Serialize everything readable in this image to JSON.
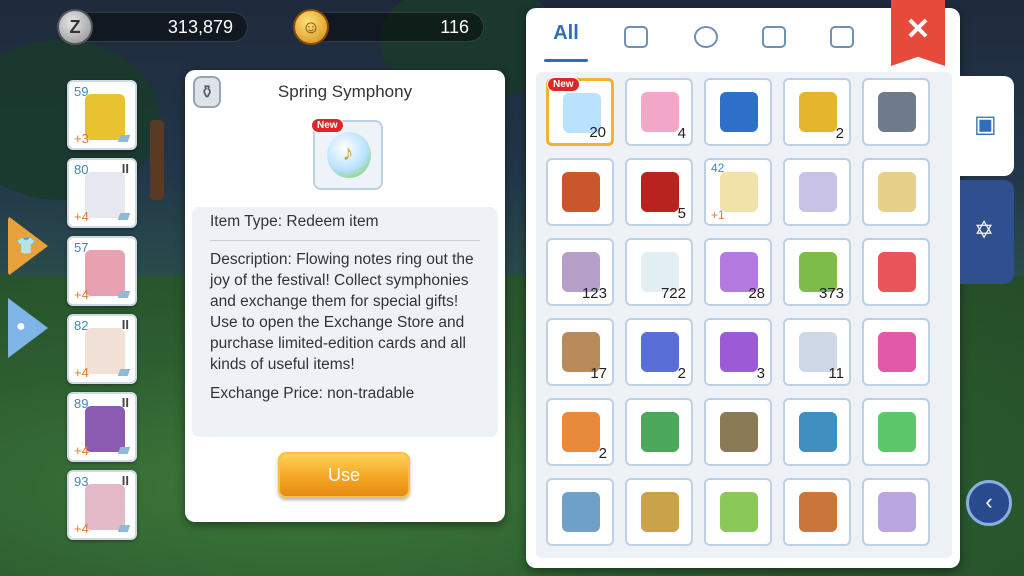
{
  "currency": {
    "zeny_icon": "Z",
    "zeny": "313,879",
    "coin_icon": "cat-coin-icon",
    "coin": "116"
  },
  "equipment": [
    {
      "level": "59",
      "tier": "",
      "refine": "+3",
      "icon": "gold-armor-icon",
      "color": "#e8c22f"
    },
    {
      "level": "80",
      "tier": "II",
      "refine": "+4",
      "icon": "white-coat-icon",
      "color": "#e5e8ee"
    },
    {
      "level": "57",
      "tier": "",
      "refine": "+4",
      "icon": "cape-icon",
      "color": "#e7a1b0"
    },
    {
      "level": "82",
      "tier": "II",
      "refine": "+4",
      "icon": "boots-icon",
      "color": "#f2e1d6"
    },
    {
      "level": "89",
      "tier": "II",
      "refine": "+4",
      "icon": "gem-accessory-icon",
      "color": "#8a5bb0"
    },
    {
      "level": "93",
      "tier": "II",
      "refine": "+4",
      "icon": "glove-icon",
      "color": "#e3b9c8"
    }
  ],
  "dialog": {
    "title": "Spring Symphony",
    "new_badge": "New",
    "item_type": "Item Type: Redeem item",
    "description": "Description: Flowing notes ring out the joy of the festival! Collect symphonies and exchange them for special gifts! Use to open the Exchange Store and purchase limited-edition cards and all kinds of useful items!",
    "price": "Exchange Price: non-tradable",
    "use_label": "Use"
  },
  "inventory": {
    "tabs": [
      {
        "label": "All",
        "icon": ""
      },
      {
        "label": "",
        "icon": "shirt-icon"
      },
      {
        "label": "",
        "icon": "potion-icon"
      },
      {
        "label": "",
        "icon": "grid-icon"
      },
      {
        "label": "",
        "icon": "card-icon"
      }
    ],
    "close_label": "✕",
    "items": [
      {
        "qty": "20",
        "icon": "spring-symphony-icon",
        "color": "#b9e2ff",
        "badge": "New",
        "selected": true
      },
      {
        "qty": "4",
        "icon": "pink-dust-icon",
        "color": "#f2a6c8"
      },
      {
        "qty": "",
        "icon": "blue-shield-card-icon",
        "color": "#2f6fc9"
      },
      {
        "qty": "2",
        "icon": "gold-card-icon",
        "color": "#e5b52b"
      },
      {
        "qty": "",
        "icon": "metal-ring-icon",
        "color": "#6f7b8a"
      },
      {
        "qty": "",
        "icon": "bird-pet-icon",
        "color": "#c9572b"
      },
      {
        "qty": "5",
        "icon": "red-sword-card-icon",
        "color": "#b8231f"
      },
      {
        "qty": "",
        "icon": "angel-icon",
        "color": "#f0e2a8",
        "level": "42",
        "refine": "+1"
      },
      {
        "qty": "",
        "icon": "hero-figure-icon",
        "color": "#c9c3e6"
      },
      {
        "qty": "",
        "icon": "spotted-egg-icon",
        "color": "#e6d08a"
      },
      {
        "qty": "123",
        "icon": "quill-icon",
        "color": "#b59fc8"
      },
      {
        "qty": "722",
        "icon": "white-feather-icon",
        "color": "#e3eef3"
      },
      {
        "qty": "28",
        "icon": "butterfly-wing-icon",
        "color": "#b57ae0"
      },
      {
        "qty": "373",
        "icon": "green-leaf-icon",
        "color": "#7dbb4a"
      },
      {
        "qty": "",
        "icon": "red-gift-box-icon",
        "color": "#e8545a"
      },
      {
        "qty": "17",
        "icon": "bag-monster-icon",
        "color": "#b98a5a"
      },
      {
        "qty": "2",
        "icon": "blue-card-pack-icon",
        "color": "#5a6fd6"
      },
      {
        "qty": "3",
        "icon": "purple-card-pack-icon",
        "color": "#9b5ad6"
      },
      {
        "qty": "11",
        "icon": "metal-box-icon",
        "color": "#cfd8e6"
      },
      {
        "qty": "",
        "icon": "gold-card-album-icon",
        "color": "#e05aa8"
      },
      {
        "qty": "2",
        "icon": "sheriff-badge-icon",
        "color": "#e88a3b"
      },
      {
        "qty": "",
        "icon": "backpack-icon",
        "color": "#4ba85a"
      },
      {
        "qty": "",
        "icon": "treasure-plate-icon",
        "color": "#8a7a55"
      },
      {
        "qty": "",
        "icon": "magic-mirror-icon",
        "color": "#3f8fbf"
      },
      {
        "qty": "",
        "icon": "mystery-card-icon",
        "color": "#5ac86a"
      },
      {
        "qty": "",
        "icon": "spell-book-icon",
        "color": "#6fa0c8"
      },
      {
        "qty": "",
        "icon": "gold-statue-icon",
        "color": "#c9a24a"
      },
      {
        "qty": "",
        "icon": "mystery-box-icon",
        "color": "#8ac85a"
      },
      {
        "qty": "",
        "icon": "leather-bag-icon",
        "color": "#c9753b"
      },
      {
        "qty": "",
        "icon": "silhouette-card-icon",
        "color": "#b9a8e0"
      }
    ]
  },
  "side_tabs": [
    {
      "icon": "backpack-tab-icon"
    },
    {
      "icon": "hexagram-tab-icon"
    }
  ],
  "back_label": "‹"
}
